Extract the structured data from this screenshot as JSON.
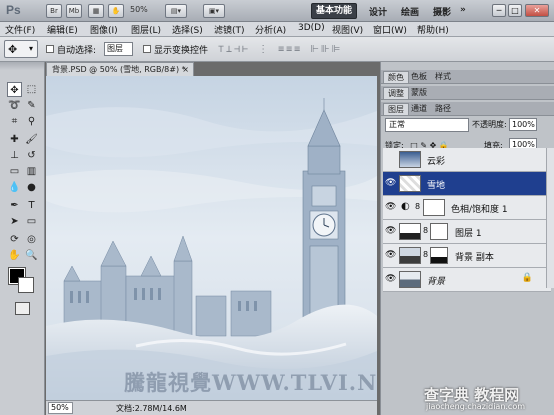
{
  "titlebar": {
    "logo": "Ps",
    "icons": [
      "Br",
      "Mb"
    ],
    "zoom": "50%",
    "workspaces": [
      "基本功能",
      "设计",
      "绘画",
      "摄影"
    ],
    "window_buttons": [
      "─",
      "□",
      "✕"
    ]
  },
  "menu": [
    "文件(F)",
    "编辑(E)",
    "图像(I)",
    "图层(L)",
    "选择(S)",
    "滤镜(T)",
    "分析(A)",
    "3D(D)",
    "视图(V)",
    "窗口(W)",
    "帮助(H)"
  ],
  "options": {
    "auto_select_label": "自动选择:",
    "auto_select_value": "图层",
    "show_transform_label": "显示变换控件",
    "align_icons": "⊤⊥⊣⊢ ⋮ ≡≡≡ ⊩⊪⊫"
  },
  "document": {
    "tab_title": "背景.PSD @ 50% (雪地, RGB/8#) *",
    "tab_close": "×",
    "zoom": "50%",
    "info": "文档:2.78M/14.6M",
    "watermark": "騰龍視覺WWW.TLVI.NET"
  },
  "panels": {
    "row1_tabs": [
      "颜色",
      "色板",
      "样式"
    ],
    "row2_tabs": [
      "调整",
      "蒙版"
    ],
    "row3_tabs": [
      "图层",
      "通道",
      "路径"
    ],
    "blend_mode": "正常",
    "opacity_label": "不透明度:",
    "opacity_value": "100%",
    "lock_label": "锁定:",
    "fill_label": "填充:",
    "fill_value": "100%",
    "layers": [
      {
        "name": "云彩",
        "visible": false,
        "selected": false
      },
      {
        "name": "雪地",
        "visible": true,
        "selected": true
      },
      {
        "name": "色相/饱和度 1",
        "visible": true,
        "selected": false
      },
      {
        "name": "图层 1",
        "visible": true,
        "selected": false
      },
      {
        "name": "背景 副本",
        "visible": true,
        "selected": false
      },
      {
        "name": "背景",
        "visible": true,
        "selected": false
      }
    ]
  },
  "overlay": {
    "site": "查字典 教程网",
    "site_sub": "jiaocheng.chazidian.com"
  }
}
